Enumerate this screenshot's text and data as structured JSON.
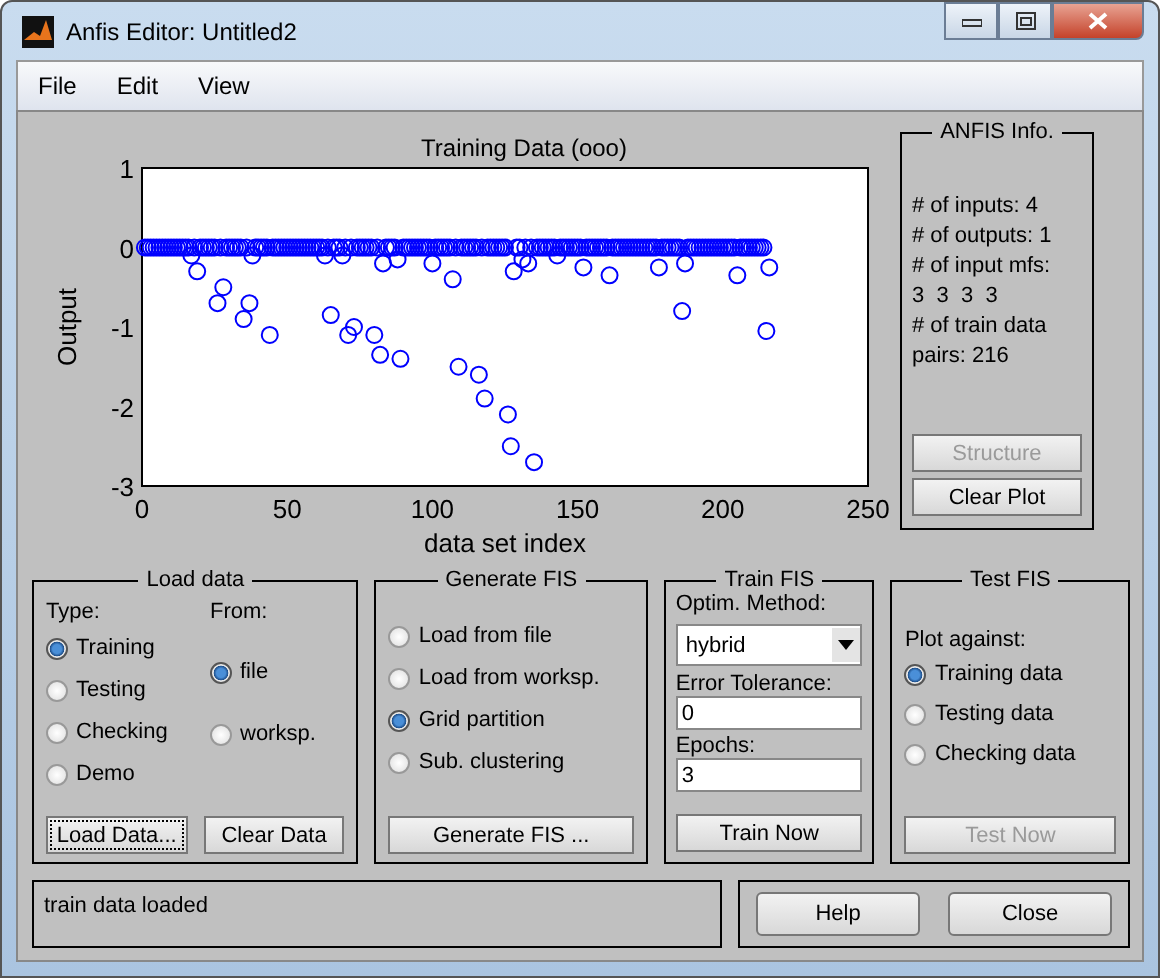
{
  "window": {
    "title": "Anfis Editor: Untitled2"
  },
  "menu": [
    {
      "label": "File"
    },
    {
      "label": "Edit"
    },
    {
      "label": "View"
    }
  ],
  "plot": {
    "chart_data": {
      "type": "scatter",
      "title": "Training Data (ooo)",
      "xlabel": "data set index",
      "ylabel": "Output",
      "xlim": [
        0,
        250
      ],
      "ylim": [
        -3,
        1
      ],
      "xticks": [
        0,
        50,
        100,
        150,
        200,
        250
      ],
      "yticks": [
        -3,
        -2,
        -1,
        0,
        1
      ],
      "x": [
        1,
        2,
        3,
        4,
        5,
        6,
        7,
        8,
        9,
        10,
        11,
        12,
        13,
        14,
        15,
        16,
        17,
        18,
        19,
        20,
        21,
        22,
        23,
        24,
        25,
        26,
        27,
        28,
        29,
        30,
        31,
        32,
        33,
        34,
        35,
        36,
        37,
        38,
        39,
        40,
        41,
        42,
        43,
        44,
        45,
        46,
        47,
        48,
        49,
        50,
        51,
        52,
        53,
        54,
        55,
        56,
        57,
        58,
        59,
        60,
        61,
        62,
        63,
        64,
        65,
        66,
        67,
        68,
        69,
        70,
        71,
        72,
        73,
        74,
        75,
        76,
        77,
        78,
        79,
        80,
        81,
        82,
        83,
        84,
        85,
        86,
        87,
        88,
        89,
        90,
        91,
        92,
        93,
        94,
        95,
        96,
        97,
        98,
        99,
        100,
        101,
        102,
        103,
        104,
        105,
        106,
        107,
        108,
        109,
        110,
        111,
        112,
        113,
        114,
        115,
        116,
        117,
        118,
        119,
        120,
        121,
        122,
        123,
        124,
        125,
        126,
        127,
        128,
        129,
        130,
        131,
        132,
        133,
        134,
        135,
        136,
        137,
        138,
        139,
        140,
        141,
        142,
        143,
        144,
        145,
        146,
        147,
        148,
        149,
        150,
        151,
        152,
        153,
        154,
        155,
        156,
        157,
        158,
        159,
        160,
        161,
        162,
        163,
        164,
        165,
        166,
        167,
        168,
        169,
        170,
        171,
        172,
        173,
        174,
        175,
        176,
        177,
        178,
        179,
        180,
        181,
        182,
        183,
        184,
        185,
        186,
        187,
        188,
        189,
        190,
        191,
        192,
        193,
        194,
        195,
        196,
        197,
        198,
        199,
        200,
        201,
        202,
        203,
        204,
        205,
        206,
        207,
        208,
        209,
        210,
        211,
        212,
        213,
        214,
        215,
        216
      ],
      "series": [
        {
          "color": "#0000ff",
          "values": [
            0,
            0,
            0,
            0,
            0,
            0,
            0,
            0,
            0,
            0,
            0,
            0,
            0,
            0,
            0,
            0,
            -0.1,
            0,
            -0.3,
            0,
            0,
            0,
            0,
            0,
            0,
            -0.7,
            0,
            -0.5,
            0,
            0,
            0,
            0,
            0,
            0,
            -0.9,
            0,
            -0.7,
            -0.1,
            0,
            0,
            0,
            0,
            0,
            -1.1,
            0,
            0,
            0,
            0,
            0,
            0,
            0,
            0,
            0,
            0,
            0,
            0,
            0,
            0,
            0,
            0,
            0,
            0,
            -0.1,
            0,
            -0.85,
            0,
            0,
            0,
            -0.1,
            0,
            -1.1,
            0,
            -1,
            0,
            0,
            0,
            0,
            0,
            0,
            -1.1,
            0,
            -1.35,
            -0.2,
            0,
            0,
            0,
            0,
            -0.15,
            -1.4,
            0,
            0,
            0,
            0,
            0,
            0,
            0,
            0,
            0,
            0,
            -0.2,
            0,
            0,
            0,
            0,
            0,
            0,
            -0.4,
            0,
            -1.5,
            0,
            0,
            0,
            0,
            0,
            0,
            -1.6,
            0,
            -1.9,
            0,
            0,
            0,
            0,
            0,
            0,
            0,
            -2.1,
            -2.5,
            -0.3,
            0,
            0,
            -0.15,
            0,
            -0.2,
            0,
            -2.7,
            0,
            0,
            0,
            0,
            0,
            0,
            0,
            -0.1,
            0,
            0,
            0,
            0,
            0,
            0,
            0,
            0,
            -0.25,
            0,
            0,
            0,
            0,
            0,
            0,
            0,
            0,
            -0.35,
            0,
            0,
            0,
            0,
            0,
            0,
            0,
            0,
            0,
            0,
            0,
            0,
            0,
            0,
            0,
            0,
            -0.25,
            0,
            0,
            0,
            0,
            0,
            0,
            0,
            -0.8,
            -0.2,
            0,
            0,
            0,
            0,
            0,
            0,
            0,
            0,
            0,
            0,
            0,
            0,
            0,
            0,
            0,
            0,
            0,
            -0.35,
            0,
            0,
            0,
            0,
            0,
            0,
            0,
            0,
            0,
            -1.05,
            -0.25
          ]
        }
      ]
    }
  },
  "anfis_info": {
    "title": "ANFIS Info.",
    "lines": [
      "# of inputs: 4",
      "# of outputs: 1",
      "# of input mfs:",
      "3  3  3  3",
      "# of train data",
      "pairs: 216"
    ],
    "buttons": [
      {
        "label": "Structure",
        "disabled": true
      },
      {
        "label": "Clear Plot",
        "disabled": false
      }
    ]
  },
  "load_data": {
    "title": "Load data",
    "type_label": "Type:",
    "from_label": "From:",
    "types": [
      {
        "label": "Training",
        "selected": true
      },
      {
        "label": "Testing",
        "selected": false
      },
      {
        "label": "Checking",
        "selected": false
      },
      {
        "label": "Demo",
        "selected": false
      }
    ],
    "sources": [
      {
        "label": "file",
        "selected": true
      },
      {
        "label": "worksp.",
        "selected": false
      }
    ],
    "buttons": [
      {
        "label": "Load Data...",
        "focused": true
      },
      {
        "label": "Clear Data",
        "focused": false
      }
    ]
  },
  "generate_fis": {
    "title": "Generate FIS",
    "options": [
      {
        "label": "Load from file",
        "selected": false
      },
      {
        "label": "Load from worksp.",
        "selected": false
      },
      {
        "label": "Grid partition",
        "selected": true
      },
      {
        "label": "Sub. clustering",
        "selected": false
      }
    ],
    "button": "Generate FIS ..."
  },
  "train_fis": {
    "title": "Train FIS",
    "method_label": "Optim. Method:",
    "method": "hybrid",
    "tolerance_label": "Error Tolerance:",
    "tolerance": "0",
    "epochs_label": "Epochs:",
    "epochs": "3",
    "button": "Train Now"
  },
  "test_fis": {
    "title": "Test FIS",
    "plot_label": "Plot against:",
    "options": [
      {
        "label": "Training data",
        "selected": true
      },
      {
        "label": "Testing data",
        "selected": false
      },
      {
        "label": "Checking data",
        "selected": false
      }
    ],
    "button": {
      "label": "Test Now",
      "disabled": true
    }
  },
  "status": "train data loaded",
  "buttons": [
    {
      "label": "Help"
    },
    {
      "label": "Close"
    }
  ]
}
